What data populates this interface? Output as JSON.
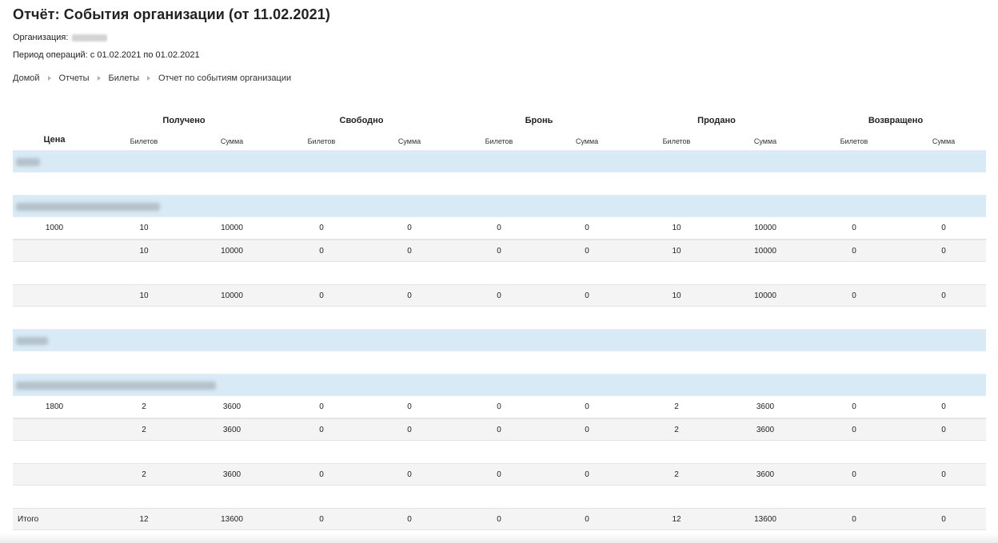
{
  "report": {
    "title": "Отчёт: События организации (от 11.02.2021)",
    "org_label": "Организация:",
    "period": "Период операций: с 01.02.2021 по 01.02.2021"
  },
  "breadcrumb": [
    "Домой",
    "Отчеты",
    "Билеты",
    "Отчет по событиям организации"
  ],
  "table": {
    "price_header": "Цена",
    "groups": [
      "Получено",
      "Свободно",
      "Бронь",
      "Продано",
      "Возвращено"
    ],
    "sub_tickets": "Билетов",
    "sub_sum": "Сумма",
    "rows": {
      "r1": [
        "1000",
        "10",
        "10000",
        "0",
        "0",
        "0",
        "0",
        "10",
        "10000",
        "0",
        "0"
      ],
      "r2": [
        "",
        "10",
        "10000",
        "0",
        "0",
        "0",
        "0",
        "10",
        "10000",
        "0",
        "0"
      ],
      "r3": [
        "",
        "10",
        "10000",
        "0",
        "0",
        "0",
        "0",
        "10",
        "10000",
        "0",
        "0"
      ],
      "r4": [
        "1800",
        "2",
        "3600",
        "0",
        "0",
        "0",
        "0",
        "2",
        "3600",
        "0",
        "0"
      ],
      "r5": [
        "",
        "2",
        "3600",
        "0",
        "0",
        "0",
        "0",
        "2",
        "3600",
        "0",
        "0"
      ],
      "r6": [
        "",
        "2",
        "3600",
        "0",
        "0",
        "0",
        "0",
        "2",
        "3600",
        "0",
        "0"
      ],
      "total": [
        "Итого",
        "12",
        "13600",
        "0",
        "0",
        "0",
        "0",
        "12",
        "13600",
        "0",
        "0"
      ]
    }
  },
  "colors": {
    "group_row": "#d7eaf6",
    "subtotal_row": "#f4f4f4"
  }
}
